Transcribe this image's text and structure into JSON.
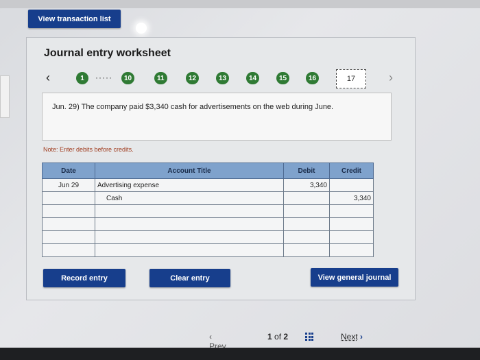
{
  "header": {
    "view_transaction_list": "View transaction list"
  },
  "worksheet": {
    "title": "Journal entry worksheet",
    "steps": [
      "1",
      "10",
      "11",
      "12",
      "13",
      "14",
      "15",
      "16"
    ],
    "current_step": "17",
    "question": "Jun. 29) The company paid $3,340 cash for advertisements on the web during June.",
    "note": "Note: Enter debits before credits."
  },
  "table": {
    "headers": {
      "date": "Date",
      "account": "Account Title",
      "debit": "Debit",
      "credit": "Credit"
    },
    "rows": [
      {
        "date": "Jun 29",
        "account": "Advertising expense",
        "debit": "3,340",
        "credit": ""
      },
      {
        "date": "",
        "account": "Cash",
        "debit": "",
        "credit": "3,340"
      },
      {
        "date": "",
        "account": "",
        "debit": "",
        "credit": ""
      },
      {
        "date": "",
        "account": "",
        "debit": "",
        "credit": ""
      },
      {
        "date": "",
        "account": "",
        "debit": "",
        "credit": ""
      },
      {
        "date": "",
        "account": "",
        "debit": "",
        "credit": ""
      }
    ]
  },
  "buttons": {
    "record": "Record entry",
    "clear": "Clear entry",
    "view_journal": "View general journal"
  },
  "pager": {
    "prev": "Prev",
    "page": "1",
    "of": "of",
    "total": "2",
    "next": "Next"
  },
  "colors": {
    "primary": "#173e8c",
    "step_green": "#2f7a34",
    "table_header": "#7fa2cc",
    "note": "#a03b1e"
  }
}
